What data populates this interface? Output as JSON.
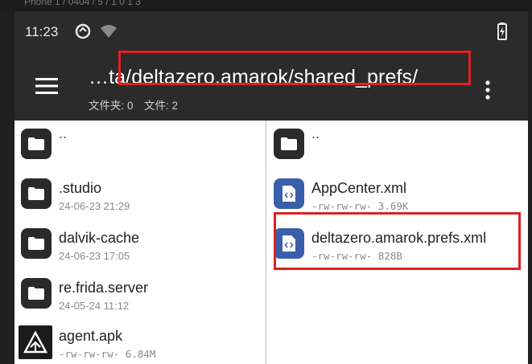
{
  "emulator": {
    "title": "Phone 1 / 0404 / 5 / 1 0 1 3"
  },
  "status_bar": {
    "time": "11:23"
  },
  "toolbar": {
    "path": "…ta/deltazero.amarok/shared_prefs/",
    "folder_label": "文件夹: 0",
    "file_label": "文件: 2"
  },
  "left_pane": {
    "items": [
      {
        "name": "..",
        "meta": "",
        "kind": "folder"
      },
      {
        "name": ".studio",
        "meta": "24-06-23 21:29",
        "kind": "folder"
      },
      {
        "name": "dalvik-cache",
        "meta": "24-06-23 17:05",
        "kind": "folder"
      },
      {
        "name": "re.frida.server",
        "meta": "24-05-24 11:12",
        "kind": "folder"
      },
      {
        "name": "agent.apk",
        "meta": "-rw-rw-rw-  6.84M",
        "kind": "apk"
      }
    ]
  },
  "right_pane": {
    "items": [
      {
        "name": "..",
        "meta": "",
        "kind": "folder"
      },
      {
        "name": "AppCenter.xml",
        "meta": "-rw-rw-rw-  3.69K",
        "kind": "xml"
      },
      {
        "name": "deltazero.amarok.prefs.xml",
        "meta": "-rw-rw-rw-  828B",
        "kind": "xml"
      }
    ]
  },
  "colors": {
    "highlight": "#e02020",
    "toolbar": "#2b2b2b",
    "xml_icon": "#3a5faa"
  }
}
